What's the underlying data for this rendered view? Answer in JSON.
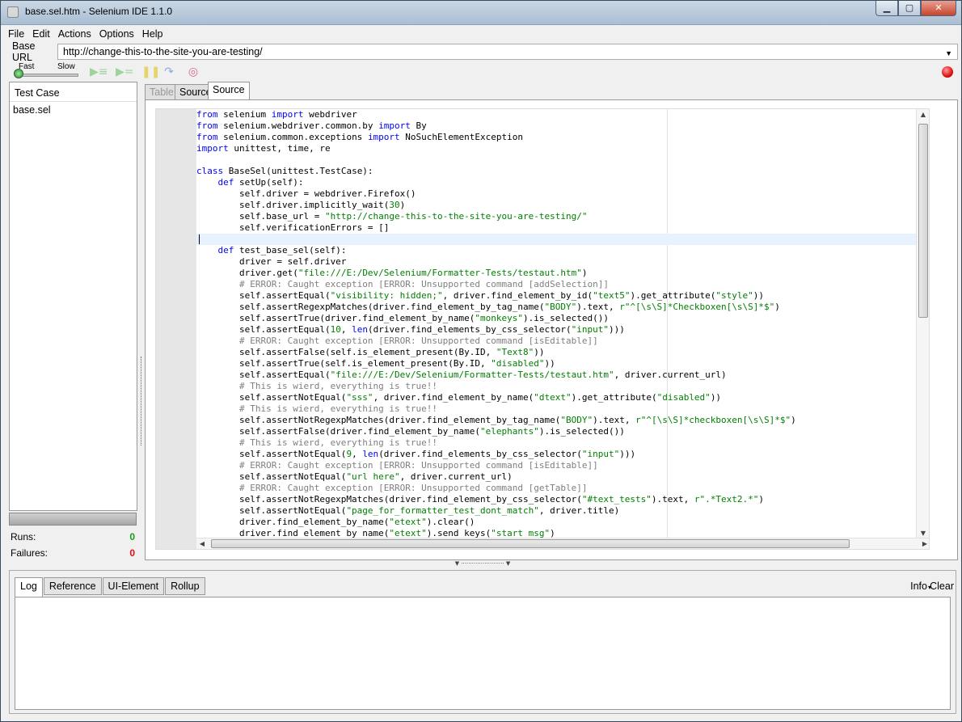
{
  "window": {
    "title": "base.sel.htm - Selenium IDE 1.1.0",
    "buttons": {
      "minimize": "▁",
      "maximize": "▢",
      "close": "✕"
    }
  },
  "menu": [
    "File",
    "Edit",
    "Actions",
    "Options",
    "Help"
  ],
  "base_url": {
    "label": "Base URL",
    "value": "http://change-this-to-the-site-you-are-testing/"
  },
  "toolbar": {
    "speed_fast": "Fast",
    "speed_slow": "Slow",
    "icons": [
      "play-all-icon",
      "play-current-icon",
      "pause-icon",
      "step-icon",
      "rollup-icon",
      "record-icon"
    ]
  },
  "test_case_panel": {
    "header": "Test Case",
    "items": [
      "base.sel"
    ],
    "runs_label": "Runs:",
    "runs_value": "0",
    "failures_label": "Failures:",
    "failures_value": "0"
  },
  "editor_tabs": [
    "Table",
    "Source",
    "Source"
  ],
  "code_lines": [
    [
      [
        "kw",
        "from"
      ],
      [
        "txt",
        " selenium "
      ],
      [
        "kw",
        "import"
      ],
      [
        "txt",
        " webdriver"
      ]
    ],
    [
      [
        "kw",
        "from"
      ],
      [
        "txt",
        " selenium.webdriver.common.by "
      ],
      [
        "kw",
        "import"
      ],
      [
        "txt",
        " By"
      ]
    ],
    [
      [
        "kw",
        "from"
      ],
      [
        "txt",
        " selenium.common.exceptions "
      ],
      [
        "kw",
        "import"
      ],
      [
        "txt",
        " NoSuchElementException"
      ]
    ],
    [
      [
        "kw",
        "import"
      ],
      [
        "txt",
        " unittest, time, re"
      ]
    ],
    [],
    [
      [
        "kw",
        "class"
      ],
      [
        "txt",
        " BaseSel(unittest.TestCase):"
      ]
    ],
    [
      [
        "txt",
        "    "
      ],
      [
        "kw",
        "def"
      ],
      [
        "txt",
        " setUp(self):"
      ]
    ],
    [
      [
        "txt",
        "        self.driver = webdriver.Firefox()"
      ]
    ],
    [
      [
        "txt",
        "        self.driver.implicitly_wait("
      ],
      [
        "num",
        "30"
      ],
      [
        "txt",
        ")"
      ]
    ],
    [
      [
        "txt",
        "        self.base_url = "
      ],
      [
        "str",
        "\"http://change-this-to-the-site-you-are-testing/\""
      ]
    ],
    [
      [
        "txt",
        "        self.verificationErrors = []"
      ]
    ],
    [],
    [
      [
        "txt",
        "    "
      ],
      [
        "kw",
        "def"
      ],
      [
        "txt",
        " test_base_sel(self):"
      ]
    ],
    [
      [
        "txt",
        "        driver = self.driver"
      ]
    ],
    [
      [
        "txt",
        "        driver.get("
      ],
      [
        "str",
        "\"file:///E:/Dev/Selenium/Formatter-Tests/testaut.htm\""
      ],
      [
        "txt",
        ")"
      ]
    ],
    [
      [
        "cmt",
        "        # ERROR: Caught exception [ERROR: Unsupported command [addSelection]]"
      ]
    ],
    [
      [
        "txt",
        "        self.assertEqual("
      ],
      [
        "str",
        "\"visibility: hidden;\""
      ],
      [
        "txt",
        ", driver.find_element_by_id("
      ],
      [
        "str",
        "\"text5\""
      ],
      [
        "txt",
        ").get_attribute("
      ],
      [
        "str",
        "\"style\""
      ],
      [
        "txt",
        "))"
      ]
    ],
    [
      [
        "txt",
        "        self.assertRegexpMatches(driver.find_element_by_tag_name("
      ],
      [
        "str",
        "\"BODY\""
      ],
      [
        "txt",
        ").text, "
      ],
      [
        "str",
        "r\"^[\\s\\S]*Checkboxen[\\s\\S]*$\""
      ],
      [
        "txt",
        ")"
      ]
    ],
    [
      [
        "txt",
        "        self.assertTrue(driver.find_element_by_name("
      ],
      [
        "str",
        "\"monkeys\""
      ],
      [
        "txt",
        ").is_selected())"
      ]
    ],
    [
      [
        "txt",
        "        self.assertEqual("
      ],
      [
        "num",
        "10"
      ],
      [
        "txt",
        ", "
      ],
      [
        "kw",
        "len"
      ],
      [
        "txt",
        "(driver.find_elements_by_css_selector("
      ],
      [
        "str",
        "\"input\""
      ],
      [
        "txt",
        ")))"
      ]
    ],
    [
      [
        "cmt",
        "        # ERROR: Caught exception [ERROR: Unsupported command [isEditable]]"
      ]
    ],
    [
      [
        "txt",
        "        self.assertFalse(self.is_element_present(By.ID, "
      ],
      [
        "str",
        "\"Text8\""
      ],
      [
        "txt",
        "))"
      ]
    ],
    [
      [
        "txt",
        "        self.assertTrue(self.is_element_present(By.ID, "
      ],
      [
        "str",
        "\"disabled\""
      ],
      [
        "txt",
        "))"
      ]
    ],
    [
      [
        "txt",
        "        self.assertEqual("
      ],
      [
        "str",
        "\"file:///E:/Dev/Selenium/Formatter-Tests/testaut.htm\""
      ],
      [
        "txt",
        ", driver.current_url)"
      ]
    ],
    [
      [
        "cmt",
        "        # This is wierd, everything is true!!"
      ]
    ],
    [
      [
        "txt",
        "        self.assertNotEqual("
      ],
      [
        "str",
        "\"sss\""
      ],
      [
        "txt",
        ", driver.find_element_by_name("
      ],
      [
        "str",
        "\"dtext\""
      ],
      [
        "txt",
        ").get_attribute("
      ],
      [
        "str",
        "\"disabled\""
      ],
      [
        "txt",
        "))"
      ]
    ],
    [
      [
        "cmt",
        "        # This is wierd, everything is true!!"
      ]
    ],
    [
      [
        "txt",
        "        self.assertNotRegexpMatches(driver.find_element_by_tag_name("
      ],
      [
        "str",
        "\"BODY\""
      ],
      [
        "txt",
        ").text, "
      ],
      [
        "str",
        "r\"^[\\s\\S]*checkboxen[\\s\\S]*$\""
      ],
      [
        "txt",
        ")"
      ]
    ],
    [
      [
        "txt",
        "        self.assertFalse(driver.find_element_by_name("
      ],
      [
        "str",
        "\"elephants\""
      ],
      [
        "txt",
        ").is_selected())"
      ]
    ],
    [
      [
        "cmt",
        "        # This is wierd, everything is true!!"
      ]
    ],
    [
      [
        "txt",
        "        self.assertNotEqual("
      ],
      [
        "num",
        "9"
      ],
      [
        "txt",
        ", "
      ],
      [
        "kw",
        "len"
      ],
      [
        "txt",
        "(driver.find_elements_by_css_selector("
      ],
      [
        "str",
        "\"input\""
      ],
      [
        "txt",
        ")))"
      ]
    ],
    [
      [
        "cmt",
        "        # ERROR: Caught exception [ERROR: Unsupported command [isEditable]]"
      ]
    ],
    [
      [
        "txt",
        "        self.assertNotEqual("
      ],
      [
        "str",
        "\"url here\""
      ],
      [
        "txt",
        ", driver.current_url)"
      ]
    ],
    [
      [
        "cmt",
        "        # ERROR: Caught exception [ERROR: Unsupported command [getTable]]"
      ]
    ],
    [
      [
        "txt",
        "        self.assertNotRegexpMatches(driver.find_element_by_css_selector("
      ],
      [
        "str",
        "\"#text_tests\""
      ],
      [
        "txt",
        ").text, "
      ],
      [
        "str",
        "r\".*Text2.*\""
      ],
      [
        "txt",
        ")"
      ]
    ],
    [
      [
        "txt",
        "        self.assertNotEqual("
      ],
      [
        "str",
        "\"page_for_formatter_test_dont_match\""
      ],
      [
        "txt",
        ", driver.title)"
      ]
    ],
    [
      [
        "txt",
        "        driver.find_element_by_name("
      ],
      [
        "str",
        "\"etext\""
      ],
      [
        "txt",
        ").clear()"
      ]
    ],
    [
      [
        "txt",
        "        driver.find_element_by_name("
      ],
      [
        "str",
        "\"etext\""
      ],
      [
        "txt",
        ").send_keys("
      ],
      [
        "str",
        "\"start msg\""
      ],
      [
        "txt",
        ")"
      ]
    ],
    []
  ],
  "current_line": 12,
  "bottom_tabs": [
    "Log",
    "Reference",
    "UI-Element",
    "Rollup"
  ],
  "bottom_actions": {
    "info": "Info",
    "clear": "Clear"
  }
}
